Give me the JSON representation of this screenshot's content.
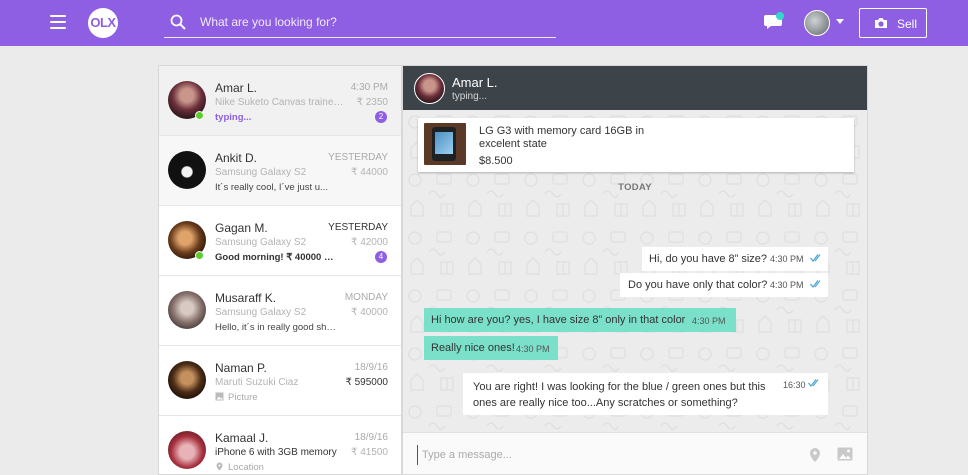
{
  "header": {
    "logo_text": "OLX",
    "search_placeholder": "What are you looking for?",
    "sell_label": "Sell",
    "brand_color": "#8e5ee3"
  },
  "conversations": [
    {
      "name": "Amar L.",
      "time": "4:30 PM",
      "item": "Nike Suketo Canvas trainee...",
      "price": "₹ 2350",
      "last": "typing...",
      "badge": "2"
    },
    {
      "name": "Ankit D.",
      "time": "YESTERDAY",
      "item": "Samsung Galaxy S2",
      "price": "₹ 44000",
      "last": "It´s really cool, I´ve just u...",
      "badge": ""
    },
    {
      "name": "Gagan M.",
      "time": "YESTERDAY",
      "item": "Samsung Galaxy S2",
      "price": "₹ 42000",
      "last": "Good morning! ₹ 40000 an...",
      "badge": "4"
    },
    {
      "name": "Musaraff K.",
      "time": "MONDAY",
      "item": "Samsung Galaxy S2",
      "price": "₹ 40000",
      "last": "Hello, it´s in really good sha...",
      "badge": ""
    },
    {
      "name": "Naman P.",
      "time": "18/9/16",
      "item": "Maruti Suzuki Ciaz",
      "price": "₹ 595000",
      "last": "Picture",
      "badge": ""
    },
    {
      "name": "Kamaal J.",
      "time": "18/9/16",
      "item": "iPhone 6 with 3GB memory",
      "price": "₹ 41500",
      "last": "Location",
      "badge": ""
    }
  ],
  "chat": {
    "name": "Amar L.",
    "status": "typing...",
    "listing": {
      "title": "LG G3 with memory card 16GB in excelent state",
      "price": "$8.500"
    },
    "date_separator": "TODAY",
    "messages": [
      {
        "text": "Hi, do you have 8” size?",
        "time": "4:30 PM",
        "direction": "out"
      },
      {
        "text": "Do you have only that color?",
        "time": "4:30 PM",
        "direction": "out"
      },
      {
        "text": "Hi how are you? yes, I have size 8” only in that color",
        "time": "4:30 PM",
        "direction": "in"
      },
      {
        "text": "Really nice ones!",
        "time": "4:30 PM",
        "direction": "in"
      },
      {
        "text": "You are right! I was looking for the blue / green ones but this ones are really nice too...Any scratches or something?",
        "time": "16:30",
        "direction": "out"
      }
    ],
    "input_placeholder": "Type a message..."
  },
  "icons": {
    "menu": "hamburger-menu-icon",
    "search": "search-icon",
    "chat": "chat-bubble-icon",
    "camera": "camera-icon",
    "picture": "picture-icon",
    "location": "location-pin-icon",
    "attach_location": "location-pin-icon",
    "attach_image": "image-icon"
  },
  "colors": {
    "incoming_bubble": "#7be0c9",
    "online": "#5ccb2e",
    "chat_header": "#3d4449"
  }
}
